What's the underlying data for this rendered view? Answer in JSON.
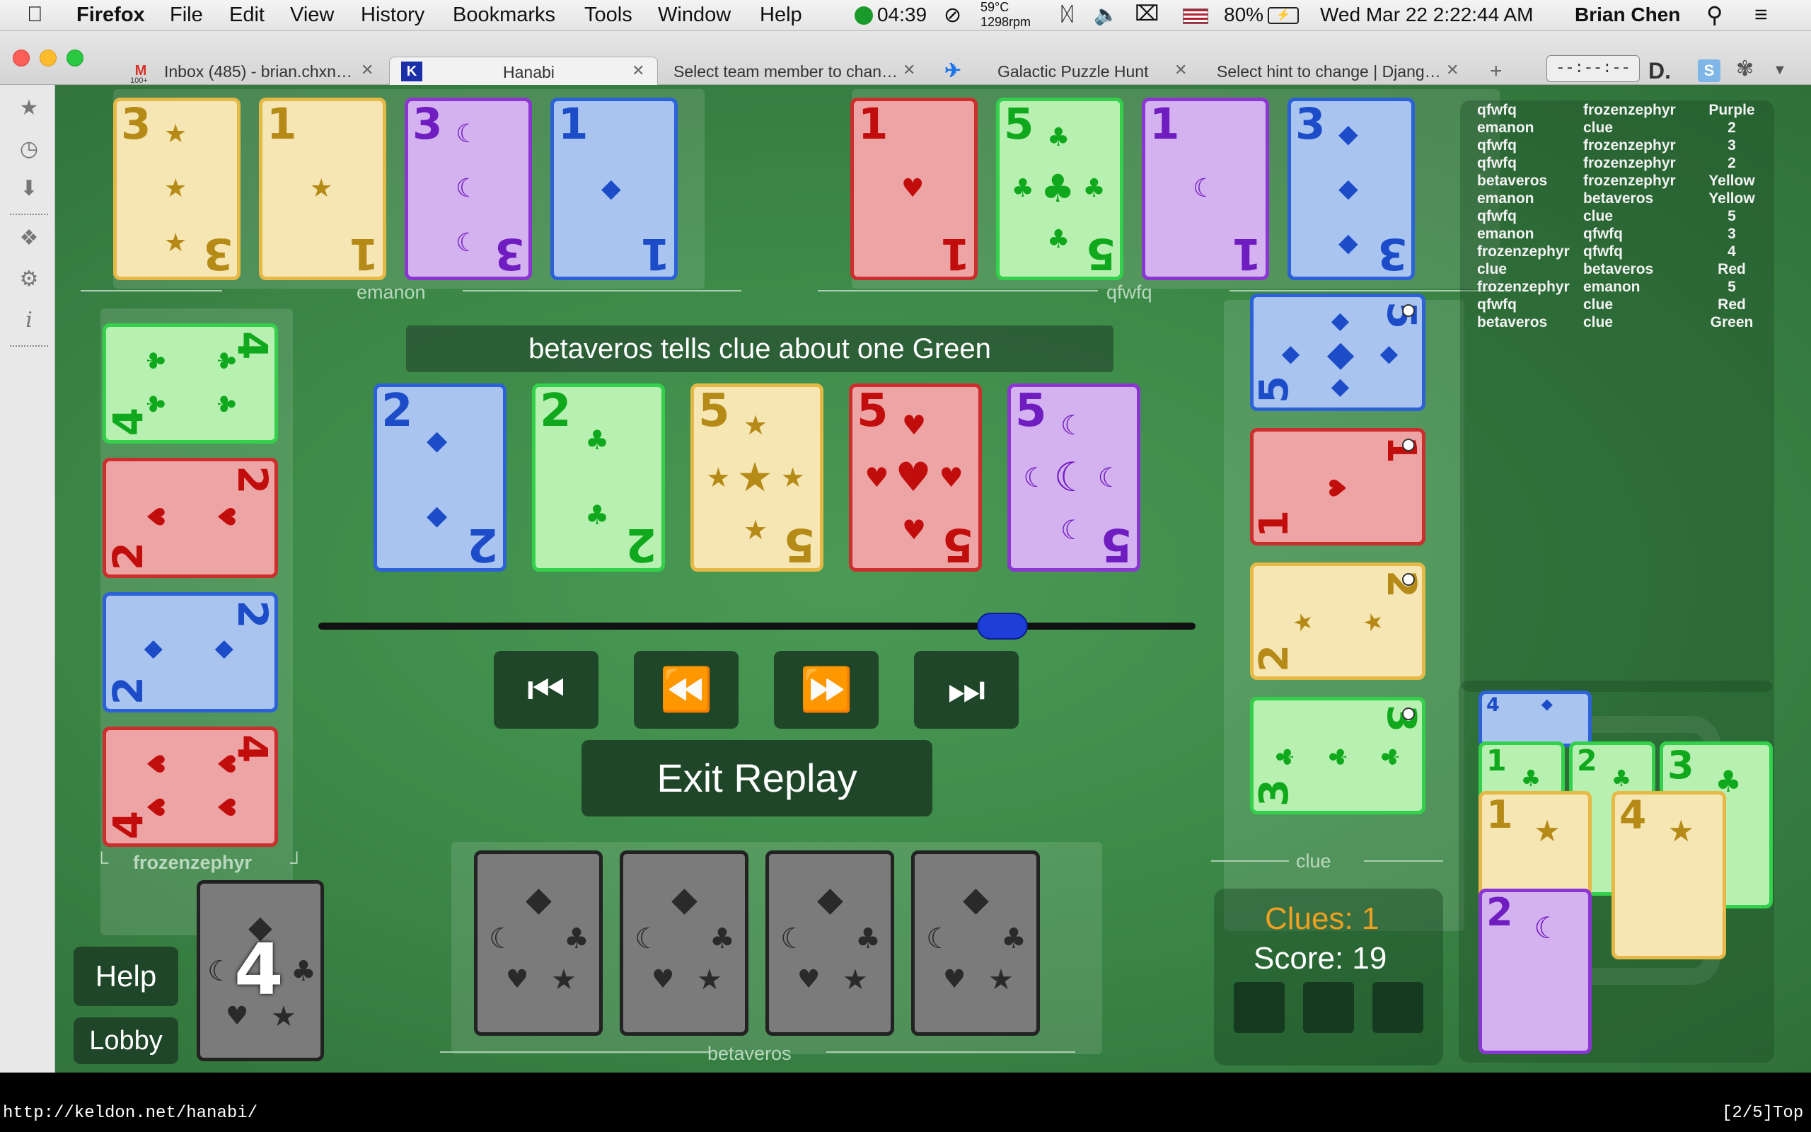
{
  "menubar": {
    "apple": "",
    "app_name": "Firefox",
    "menus": [
      "File",
      "Edit",
      "View",
      "History",
      "Bookmarks",
      "Tools",
      "Window",
      "Help"
    ],
    "timer": "04:39",
    "temp": "59°C",
    "rpm": "1298rpm",
    "battery": "80%",
    "datetime": "Wed Mar 22  2:22:44 AM",
    "user": "Brian Chen"
  },
  "tabs": [
    {
      "label": "Inbox (485) - brian.chxn…",
      "icon": "M",
      "badge": "100+"
    },
    {
      "label": "Hanabi",
      "icon": "K"
    },
    {
      "label": "Select team member to chan…",
      "icon": ""
    },
    {
      "label": "Galactic Puzzle Hunt",
      "icon": "✈"
    },
    {
      "label": "Select hint to change | Djang…",
      "icon": ""
    }
  ],
  "tab_new": "+",
  "toolbar_clock": "--:--:--",
  "toolbar_d": "D.",
  "players": {
    "emanon": "emanon",
    "qfwfq": "qfwfq",
    "frozenzephyr": "frozenzephyr",
    "clue": "clue",
    "betaveros": "betaveros"
  },
  "hands": {
    "emanon": [
      {
        "rank": "3",
        "suit": "Yellow",
        "symbol": "★"
      },
      {
        "rank": "1",
        "suit": "Yellow",
        "symbol": "★"
      },
      {
        "rank": "3",
        "suit": "Purple",
        "symbol": "☾"
      },
      {
        "rank": "1",
        "suit": "Blue",
        "symbol": "◆"
      }
    ],
    "qfwfq": [
      {
        "rank": "1",
        "suit": "Red",
        "symbol": "♥"
      },
      {
        "rank": "5",
        "suit": "Green",
        "symbol": "♣"
      },
      {
        "rank": "1",
        "suit": "Purple",
        "symbol": "☾"
      },
      {
        "rank": "3",
        "suit": "Blue",
        "symbol": "◆"
      }
    ],
    "frozenzephyr": [
      {
        "rank": "4",
        "suit": "Green",
        "symbol": "♣"
      },
      {
        "rank": "2",
        "suit": "Red",
        "symbol": "♥"
      },
      {
        "rank": "2",
        "suit": "Blue",
        "symbol": "◆"
      },
      {
        "rank": "4",
        "suit": "Red",
        "symbol": "♥"
      }
    ],
    "clue": [
      {
        "rank": "5",
        "suit": "Blue",
        "symbol": "◆"
      },
      {
        "rank": "1",
        "suit": "Red",
        "symbol": "♥"
      },
      {
        "rank": "2",
        "suit": "Yellow",
        "symbol": "★"
      },
      {
        "rank": "3",
        "suit": "Green",
        "symbol": "♣"
      }
    ],
    "betaveros": [
      {
        "rank": ""
      },
      {
        "rank": ""
      },
      {
        "rank": ""
      },
      {
        "rank": ""
      }
    ]
  },
  "play_area": [
    {
      "rank": "2",
      "suit": "Blue",
      "symbol": "◆"
    },
    {
      "rank": "2",
      "suit": "Green",
      "symbol": "♣"
    },
    {
      "rank": "5",
      "suit": "Yellow",
      "symbol": "★"
    },
    {
      "rank": "5",
      "suit": "Red",
      "symbol": "♥"
    },
    {
      "rank": "5",
      "suit": "Purple",
      "symbol": "☾"
    }
  ],
  "banner": "betaveros tells clue about one Green",
  "replay": {
    "position": 0.78,
    "buttons": [
      "⏮",
      "⏪",
      "⏩",
      "⏭"
    ],
    "exit_label": "Exit Replay"
  },
  "deck_count": "4",
  "help_label": "Help",
  "lobby_label": "Lobby",
  "clues_label": "Clues: 1",
  "score_label": "Score: 19",
  "strikes": 3,
  "log": [
    [
      "qfwfq",
      "frozenzephyr",
      "Purple"
    ],
    [
      "emanon",
      "clue",
      "2"
    ],
    [
      "qfwfq",
      "frozenzephyr",
      "3"
    ],
    [
      "qfwfq",
      "frozenzephyr",
      "2"
    ],
    [
      "betaveros",
      "frozenzephyr",
      "Yellow"
    ],
    [
      "emanon",
      "betaveros",
      "Yellow"
    ],
    [
      "qfwfq",
      "clue",
      "5"
    ],
    [
      "emanon",
      "qfwfq",
      "3"
    ],
    [
      "frozenzephyr",
      "qfwfq",
      "4"
    ],
    [
      "clue",
      "betaveros",
      "Red"
    ],
    [
      "frozenzephyr",
      "emanon",
      "5"
    ],
    [
      "qfwfq",
      "clue",
      "Red"
    ],
    [
      "betaveros",
      "clue",
      "Green"
    ]
  ],
  "discards": [
    {
      "rank": "4",
      "suit": "Blue",
      "symbol": "◆"
    },
    {
      "rank": "1",
      "suit": "Green",
      "symbol": "♣"
    },
    {
      "rank": "2",
      "suit": "Green",
      "symbol": "♣"
    },
    {
      "rank": "3",
      "suit": "Green",
      "symbol": "♣"
    },
    {
      "rank": "1",
      "suit": "Yellow",
      "symbol": "★"
    },
    {
      "rank": "4",
      "suit": "Yellow",
      "symbol": "★"
    },
    {
      "rank": "2",
      "suit": "Purple",
      "symbol": "☾"
    }
  ],
  "status": {
    "url": "http://keldon.net/hanabi/",
    "position": "[2/5]Top"
  },
  "colors": {
    "table": "#3d8a48",
    "clues_text": "#f0a020",
    "knob": "#1f3dd8"
  }
}
